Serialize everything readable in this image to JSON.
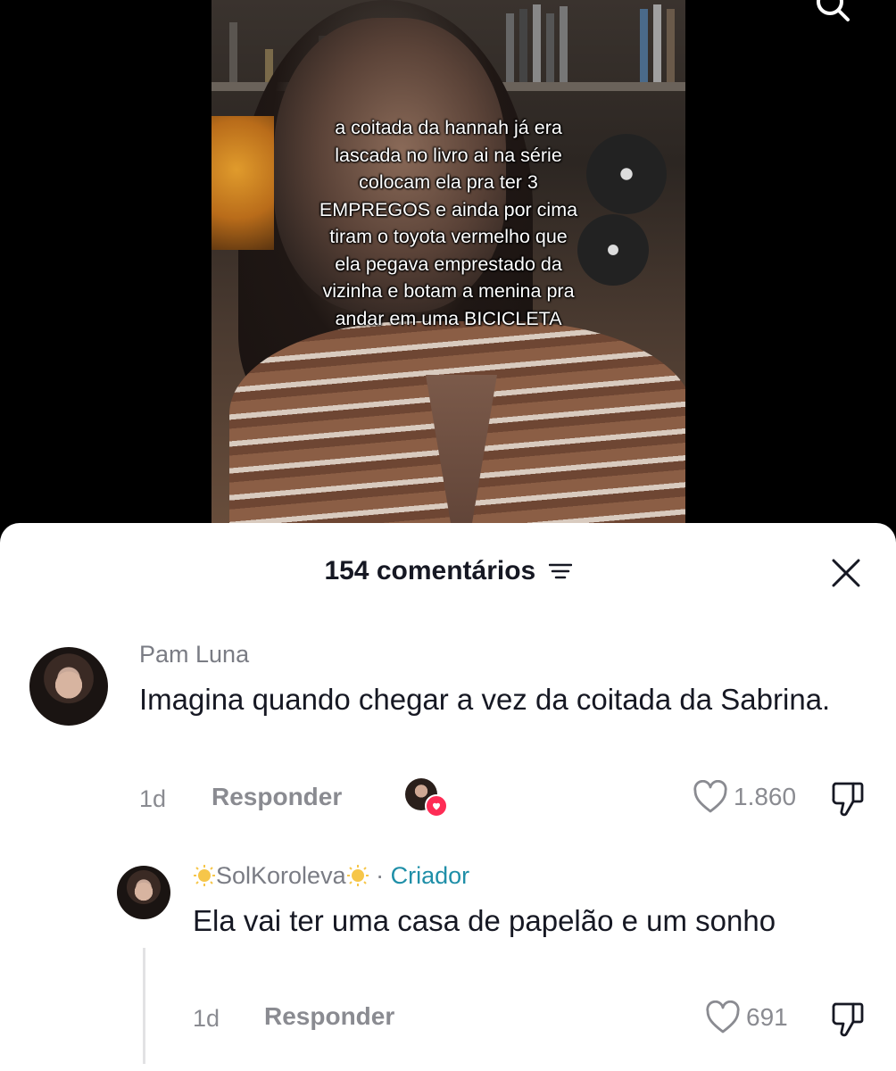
{
  "video": {
    "caption_lines": [
      "a coitada da hannah já era",
      "lascada no livro ai na série",
      "colocam ela pra ter 3",
      "EMPREGOS e ainda por cima",
      "tiram o toyota vermelho que",
      "ela pegava emprestado da",
      "vizinha e botam a menina pra",
      "andar em uma BICICLETA"
    ]
  },
  "comments_header": {
    "title": "154 comentários"
  },
  "comments": [
    {
      "username": "Pam Luna",
      "text": "Imagina quando chegar a vez da coitada da Sabrina.",
      "time": "1d",
      "reply_label": "Responder",
      "likes": "1.860"
    },
    {
      "username": "SolKoroleva",
      "separator": "·",
      "badge": "Criador",
      "text": "Ela vai ter uma casa de papelão e um sonho",
      "time": "1d",
      "reply_label": "Responder",
      "likes": "691"
    }
  ],
  "colors": {
    "creator_badge": "#1f8fa8",
    "like_heart_badge": "#fe2c55",
    "text_primary": "#161823",
    "text_secondary": "#8a8b91"
  }
}
